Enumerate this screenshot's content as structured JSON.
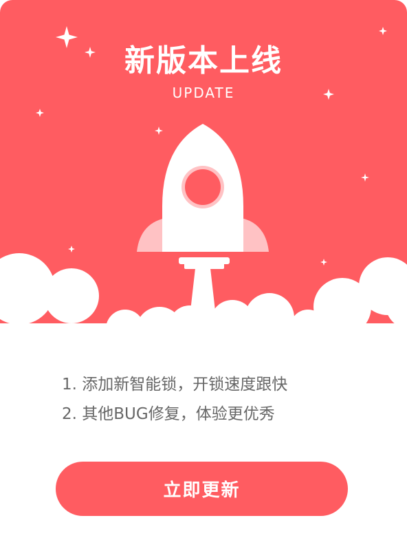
{
  "header": {
    "title": "新版本上线",
    "subtitle": "UPDATE"
  },
  "illustration": {
    "icons": [
      "sparkle-star-icon",
      "rocket-icon",
      "cloud-icon"
    ],
    "colors": {
      "hero_background": "#ff5c61",
      "rocket_body": "#ffffff",
      "rocket_fins": "#ffc2c4",
      "rocket_window": "#ff5c61",
      "clouds": "#ffffff"
    }
  },
  "notes": {
    "items": [
      "1. 添加新智能锁，开锁速度跟快",
      "2. 其他BUG修复，体验更优秀"
    ]
  },
  "action": {
    "update_label": "立即更新",
    "button_color": "#ff5c61"
  }
}
